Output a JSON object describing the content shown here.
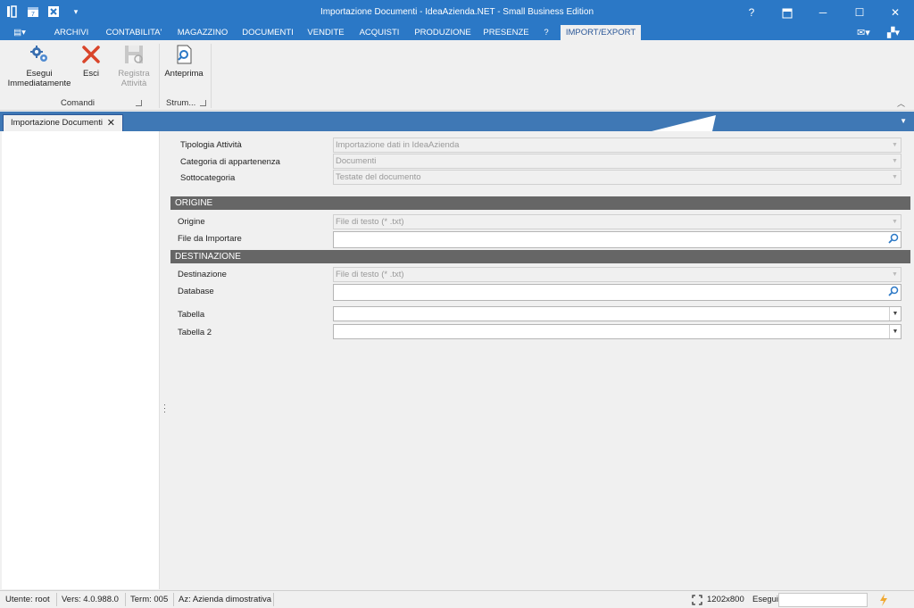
{
  "window": {
    "title": "Importazione Documenti - IdeaAzienda.NET - Small Business Edition",
    "help_label": "?",
    "minimize_label": "─",
    "maximize_label": "☐",
    "close_label": "✕"
  },
  "menu": {
    "items": [
      "ARCHIVI",
      "CONTABILITA'",
      "MAGAZZINO",
      "DOCUMENTI",
      "VENDITE",
      "ACQUISTI",
      "PRODUZIONE",
      "PRESENZE",
      "?",
      "IMPORT/EXPORT"
    ],
    "active": "IMPORT/EXPORT"
  },
  "ribbon": {
    "esegui_label": "Esegui\nImmediatamente",
    "esci_label": "Esci",
    "registra_label": "Registra\nAttività",
    "anteprima_label": "Anteprima",
    "group_comandi": "Comandi",
    "group_strumenti": "Strum..."
  },
  "doc_tab": {
    "label": "Importazione Documenti",
    "close": "✕"
  },
  "form": {
    "tipologia_label": "Tipologia Attività",
    "tipologia_value": "Importazione dati in IdeaAzienda",
    "categoria_label": "Categoria di appartenenza",
    "categoria_value": "Documenti",
    "sottocategoria_label": "Sottocategoria",
    "sottocategoria_value": "Testate del documento",
    "origine_header": "ORIGINE",
    "origine_label": "Origine",
    "origine_value": "File di testo (* .txt)",
    "file_label": "File da Importare",
    "file_value": "",
    "destinazione_header": "DESTINAZIONE",
    "destinazione_label": "Destinazione",
    "destinazione_value": "File di testo (* .txt)",
    "database_label": "Database",
    "database_value": "",
    "tabella_label": "Tabella",
    "tabella_value": "",
    "tabella2_label": "Tabella 2",
    "tabella2_value": ""
  },
  "status": {
    "utente": "Utente: root",
    "versione": "Vers: 4.0.988.0",
    "terminale": "Term: 005",
    "azienda": "Az: Azienda dimostrativa",
    "resolution": "1202x800",
    "esegui_label": "Esegui",
    "esegui_value": ""
  },
  "colors": {
    "titlebar": "#2b78c6",
    "tabstrip": "#3f78b5",
    "section_header": "#666666",
    "esci_icon": "#d9452b"
  },
  "icons": [
    "gears-icon",
    "close-x-icon",
    "save-disk-icon",
    "preview-magnifier-icon",
    "search-icon",
    "lightning-icon",
    "fullscreen-icon"
  ]
}
